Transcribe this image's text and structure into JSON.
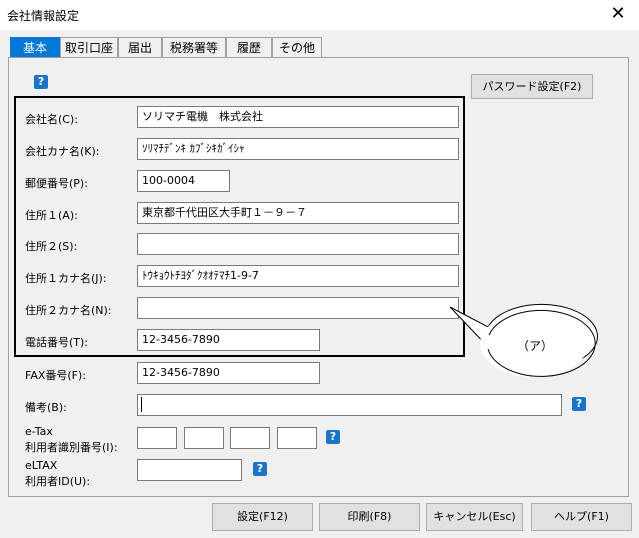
{
  "window": {
    "title": "会社情報設定",
    "close_glyph": "✕"
  },
  "tabs": [
    {
      "label": "基本",
      "active": true
    },
    {
      "label": "取引口座"
    },
    {
      "label": "届出"
    },
    {
      "label": "税務署等"
    },
    {
      "label": "履歴"
    },
    {
      "label": "その他"
    }
  ],
  "help_glyph": "?",
  "password_button": "パスワード設定(F2)",
  "fields": {
    "company_name": {
      "label": "会社名(C):",
      "value": "ソリマチ電機　株式会社"
    },
    "company_kana": {
      "label": "会社カナ名(K):",
      "value": "ｿﾘﾏﾁﾃﾞﾝｷ ｶﾌﾞｼｷｶﾞｲｼｬ"
    },
    "postal_code": {
      "label": "郵便番号(P):",
      "value": "100-0004"
    },
    "address1": {
      "label": "住所１(A):",
      "value": "東京都千代田区大手町１－９－７"
    },
    "address2": {
      "label": "住所２(S):",
      "value": ""
    },
    "address1_kana": {
      "label": "住所１カナ名(J):",
      "value": "ﾄｳｷｮｳﾄﾁﾖﾀﾞｸｵｵﾃﾏﾁ1-9-7"
    },
    "address2_kana": {
      "label": "住所２カナ名(N):",
      "value": ""
    },
    "phone": {
      "label": "電話番号(T):",
      "value": "12-3456-7890"
    },
    "fax": {
      "label": "FAX番号(F):",
      "value": "12-3456-7890"
    },
    "memo": {
      "label": "備考(B):",
      "value": ""
    },
    "etax": {
      "label_line1": "e-Tax",
      "label_line2": "利用者識別番号(I):"
    },
    "eltax": {
      "label_line1": "eLTAX",
      "label_line2": "利用者ID(U):"
    }
  },
  "callout": {
    "text": "（ア）"
  },
  "buttons": {
    "settings": "設定(F12)",
    "print": "印刷(F8)",
    "cancel": "キャンセル(Esc)",
    "help": "ヘルプ(F1)"
  }
}
